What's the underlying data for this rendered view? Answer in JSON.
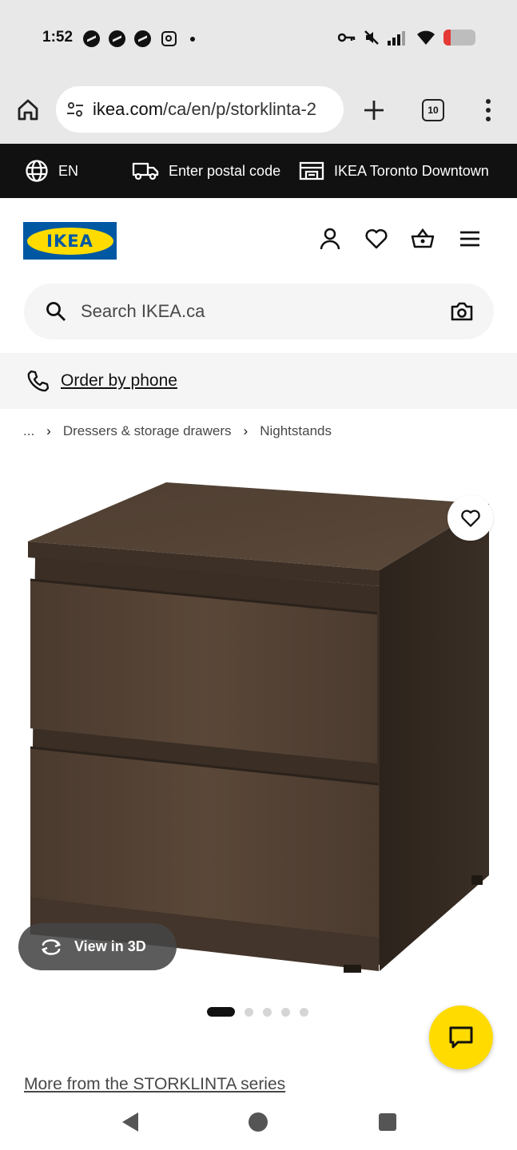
{
  "status_bar": {
    "time": "1:52"
  },
  "browser": {
    "url_host": "ikea.com",
    "url_path": "/ca/en/p/storklinta-2",
    "tab_count": "10"
  },
  "topbar": {
    "language": "EN",
    "postal_code_label": "Enter postal code",
    "store_label": "IKEA Toronto Downtown"
  },
  "header": {
    "logo_text": "IKEA"
  },
  "search": {
    "placeholder": "Search IKEA.ca"
  },
  "phone": {
    "label": "Order by phone"
  },
  "breadcrumb": {
    "ellipsis": "...",
    "items": [
      "Dressers & storage drawers",
      "Nightstands"
    ]
  },
  "product": {
    "view_3d_label": "View in 3D",
    "image_count": 5,
    "active_image": 1,
    "series_link": "More from the STORKLINTA series"
  },
  "colors": {
    "ikea_blue": "#0058a3",
    "ikea_yellow": "#ffdb00",
    "topbar_bg": "#111111",
    "battery_low": "#e53935"
  }
}
